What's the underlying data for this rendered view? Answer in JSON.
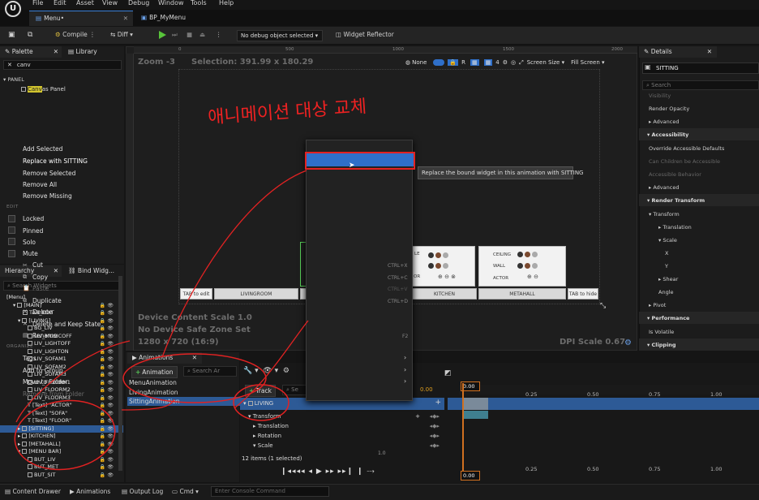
{
  "app": {
    "logo": "U"
  },
  "menubar": {
    "items": [
      "File",
      "Edit",
      "Asset",
      "View",
      "Debug",
      "Window",
      "Tools",
      "Help"
    ]
  },
  "tabs": [
    {
      "label": "Menu•"
    },
    {
      "label": "BP_MyMenu"
    }
  ],
  "toolbar": {
    "compile": "Compile",
    "diff": "Diff",
    "debug_select": "No debug object selected",
    "widget_reflector": "Widget Reflector"
  },
  "palette": {
    "tab_label": "Palette",
    "library_label": "Library",
    "search_value": "canv",
    "category": "PANEL",
    "item_prefix": "Canv",
    "item_suffix": "as Panel"
  },
  "hierarchy": {
    "tab_label": "Hierarchy",
    "bind_label": "Bind Widg...",
    "search_placeholder": "Search Widgets",
    "rows": [
      "[Menu]",
      "[MAIN]",
      "TAB_EDIT",
      "[LIVING]",
      "BG_LIV",
      "LIV_MUSICOFF",
      "LIV_LIGHTOFF",
      "LIV_LIGHTON",
      "LIV_SOFAM1",
      "LIV_SOFAM2",
      "LIV_SOFAM3",
      "LIV_FLOORM1",
      "LIV_FLOORM2",
      "LIV_FLOORM3",
      "[Text] \"ACTOR\"",
      "[Text] \"SOFA\"",
      "[Text] \"FLOOR\"",
      "[SITTING]",
      "[KITCHEN]",
      "[METAHALL]",
      "[MENU BAR]",
      "BUT_LIV",
      "BUT_MET",
      "BUT_SIT"
    ]
  },
  "viewport": {
    "zoom": "Zoom -3",
    "selection": "Selection: 391.99 x 180.29",
    "none_label": "None",
    "r_label": "R",
    "grid_num": "4",
    "screen_size": "Screen Size",
    "fill_screen": "Fill Screen",
    "device_scale": "Device Content Scale 1.0",
    "safe_zone": "No Device Safe Zone Set",
    "resolution": "1280 x 720 (16:9)",
    "dpi": "DPI Scale 0.67",
    "ruler_marks": [
      "0",
      "500",
      "1000",
      "1500",
      "2000"
    ],
    "canvas_bar": [
      "TAB to edit",
      "LIVINGROOM",
      "KITCHEN",
      "METAHALL",
      "TAB to hide"
    ],
    "card_kitchen": [
      "LE",
      "OR"
    ],
    "card_meta": [
      "CEILING",
      "WALL",
      "ACTOR"
    ]
  },
  "context_menu": {
    "items": {
      "add_selected": "Add Selected",
      "replace_with": "Replace with SITTING",
      "remove_selected": "Remove Selected",
      "remove_all": "Remove All",
      "remove_missing": "Remove Missing",
      "section_edit": "EDIT",
      "locked": "Locked",
      "pinned": "Pinned",
      "solo": "Solo",
      "mute": "Mute",
      "cut": "Cut",
      "copy": "Copy",
      "paste": "Paste",
      "duplicate": "Duplicate",
      "delete": "Delete",
      "delete_keep": "Delete and Keep State",
      "rename": "Rename",
      "section_organize": "ORGANIZE",
      "tags": "Tags",
      "add_to_group": "Add to Group",
      "move_to_folder": "Move to Folder",
      "remove_from_folder": "Remove from Folder"
    },
    "shortcuts": {
      "cut": "CTRL+X",
      "copy": "CTRL+C",
      "paste": "CTRL+V",
      "duplicate": "CTRL+D",
      "rename": "F2"
    }
  },
  "tooltip": "Replace the bound widget in this animation with SITTING",
  "annotation": {
    "handwritten": "애니메이션 대상 교체"
  },
  "details": {
    "tab_label": "Details",
    "name_value": "SITTING",
    "search_placeholder": "Search",
    "rows": {
      "visibility": "Visibility",
      "render_opacity": "Render Opacity",
      "advanced1": "Advanced",
      "accessibility": "Accessibility",
      "override": "Override Accessible Defaults",
      "can_children": "Can Children be Accessible",
      "accessible_behavior": "Accessible Behavior",
      "advanced2": "Advanced",
      "render_transform": "Render Transform",
      "transform": "Transform",
      "translation": "Translation",
      "scale": "Scale",
      "x": "X",
      "y": "Y",
      "shear": "Shear",
      "angle": "Angle",
      "pivot": "Pivot",
      "performance": "Performance",
      "is_volatile": "Is Volatile",
      "clipping": "Clipping"
    }
  },
  "animations": {
    "tab_label": "Animations",
    "add_button": "Animation",
    "search_placeholder": "Search Ar",
    "list": [
      "MenuAnimation",
      "LivingAnimation",
      "SittingAnimation"
    ]
  },
  "sequencer": {
    "track_button": "Track",
    "search_placeholder": "Se",
    "frame_value": "0.00",
    "tracks": [
      "LIVING",
      "Transform",
      "Translation",
      "Rotation",
      "Scale"
    ],
    "scale_value": "1.0",
    "items_status": "12 items (1 selected)",
    "time_marks": [
      "0.00",
      "0.25",
      "0.50",
      "0.75",
      "1.00"
    ]
  },
  "bottombar": {
    "content_drawer": "Content Drawer",
    "animations": "Animations",
    "output_log": "Output Log",
    "cmd": "Cmd",
    "console_placeholder": "Enter Console Command"
  },
  "colors": {
    "accent": "#2f6fc9",
    "selection": "#2d5a96",
    "annotation": "#e22222",
    "play": "#58c43a"
  }
}
